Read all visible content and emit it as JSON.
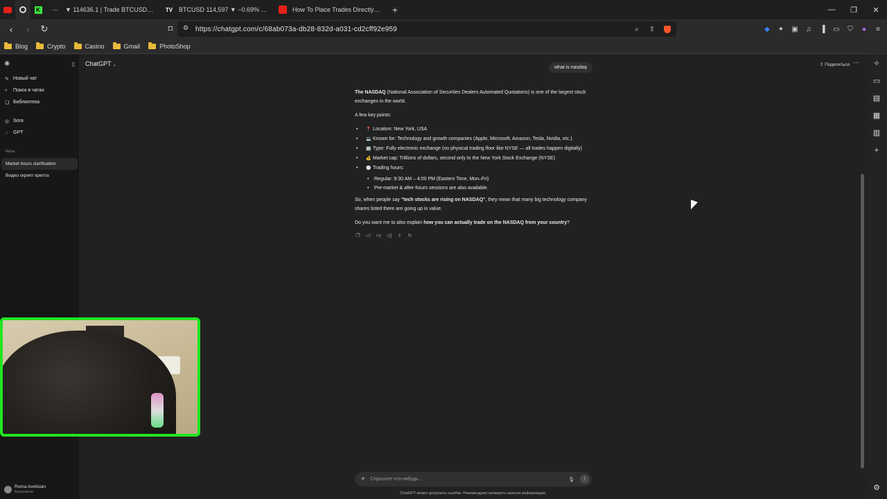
{
  "browser": {
    "tabs": [
      {
        "label": "▼ 114636.1 | Trade BTCUSDT | Bybit",
        "icon": "bybit-icon"
      },
      {
        "label": "BTCUSD 114,597 ▼ −0.69% Без назв",
        "icon": "tradingview-icon"
      },
      {
        "label": "How To Place Trades Directly on Trad",
        "icon": "youtube-icon"
      }
    ],
    "url": "https://chatgpt.com/c/68ab073a-db28-832d-a031-cd2cff92e959",
    "bookmarks": [
      "Blog",
      "Crypto",
      "Casino",
      "Gmail",
      "PhotoShop"
    ]
  },
  "sidebar": {
    "items": [
      {
        "label": "Новый чат",
        "icon": "edit-icon"
      },
      {
        "label": "Поиск в чатах",
        "icon": "search-icon"
      },
      {
        "label": "Библиотека",
        "icon": "library-icon"
      }
    ],
    "tools": [
      {
        "label": "Sora",
        "icon": "sora-icon"
      },
      {
        "label": "GPT",
        "icon": "gpt-icon"
      }
    ],
    "section_label": "Чаты",
    "chats": [
      "Market hours clarification",
      "Видео скрипт крипта"
    ],
    "user": {
      "name": "Roma Avetisian",
      "plan": "Бесплатно"
    }
  },
  "header": {
    "model": "ChatGPT",
    "share_label": "Поделиться"
  },
  "conversation": {
    "user_message": "what is nasdaq",
    "intro_bold": "The NASDAQ",
    "intro_rest": " (National Association of Securities Dealers Automated Quotations) is one of the largest stock exchanges in the world.",
    "key_points_title": "A few key points:",
    "points": [
      {
        "emoji": "📍",
        "label": "Location:",
        "text": " New York, USA"
      },
      {
        "emoji": "💻",
        "label": "Known for:",
        "text": " Technology and growth companies (Apple, Microsoft, Amazon, Tesla, Nvidia, etc.)"
      },
      {
        "emoji": "🏢",
        "label": "Type:",
        "text": " Fully electronic exchange (no physical trading floor like NYSE — all trades happen digitally)"
      },
      {
        "emoji": "💰",
        "label": "Market cap:",
        "text": " Trillions of dollars, second only to the New York Stock Exchange (NYSE)"
      },
      {
        "emoji": "🕒",
        "label": "Trading hours:",
        "text": ""
      }
    ],
    "sub_points": [
      {
        "label": "Regular:",
        "text": " 9:30 AM – 4:00 PM (Eastern Time, Mon–Fri)"
      },
      {
        "label": "Pre-market & after-hours",
        "text": " sessions are also available."
      }
    ],
    "summary_pre": "So, when people say ",
    "summary_bold": "\"tech stocks are rising on NASDAQ\"",
    "summary_post": ", they mean that many big technology company shares listed there are going up in value.",
    "question_pre": "Do you want me to also explain ",
    "question_bold": "how you can actually trade on the NASDAQ from your country",
    "question_post": "?"
  },
  "composer": {
    "placeholder": "Спросите что-нибудь...",
    "disclaimer": "ChatGPT может допускать ошибки. Рекомендуем проверять важную информацию."
  }
}
